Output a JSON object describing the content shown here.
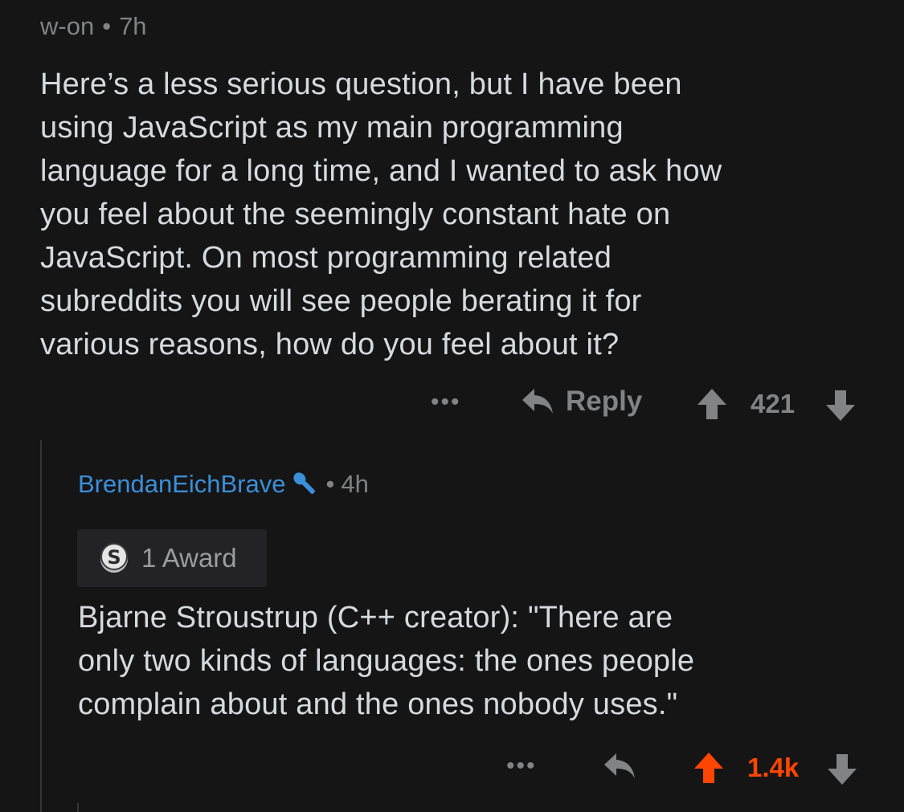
{
  "parent_comment": {
    "author": "w-on",
    "separator": "•",
    "time": "7h",
    "body": "Here’s a less serious question, but I have been\nusing JavaScript as my main programming\nlanguage for a long time, and I wanted to ask how\nyou feel about the seemingly constant hate on\nJavaScript. On most programming related\nsubreddits you will see people berating it for\nvarious reasons, how do you feel about it?",
    "more_label": "•••",
    "reply_label": "Reply",
    "score": "421"
  },
  "child_comment": {
    "author": "BrendanEichBrave",
    "separator": "•",
    "time": "4h",
    "award_label": "1 Award",
    "body": "Bjarne Stroustrup (C++ creator): \"There are\nonly two kinds of languages: the ones people\ncomplain about and the ones nobody uses.\"",
    "more_label": "•••",
    "score": "1.4k",
    "upvoted": true
  },
  "colors": {
    "background": "#151516",
    "text": "#d7dadc",
    "muted": "#818384",
    "username": "#3a8fd9",
    "upvote_active": "#ff4500",
    "thread_line": "#343536"
  }
}
